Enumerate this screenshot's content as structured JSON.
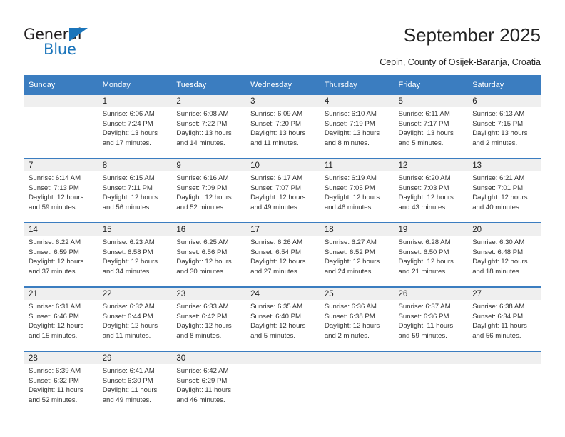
{
  "brand": {
    "word_one": "General",
    "word_two": "Blue",
    "accent_color": "#1b75bb"
  },
  "header": {
    "title": "September 2025",
    "subtitle": "Cepin, County of Osijek-Baranja, Croatia"
  },
  "calendar": {
    "header_bg": "#3b7dc0",
    "daynum_bg": "#efefef",
    "weekday_names": [
      "Sunday",
      "Monday",
      "Tuesday",
      "Wednesday",
      "Thursday",
      "Friday",
      "Saturday"
    ],
    "weeks": [
      [
        {
          "day": "",
          "sunrise": "",
          "sunset": "",
          "daylight_1": "",
          "daylight_2": ""
        },
        {
          "day": "1",
          "sunrise": "Sunrise: 6:06 AM",
          "sunset": "Sunset: 7:24 PM",
          "daylight_1": "Daylight: 13 hours",
          "daylight_2": "and 17 minutes."
        },
        {
          "day": "2",
          "sunrise": "Sunrise: 6:08 AM",
          "sunset": "Sunset: 7:22 PM",
          "daylight_1": "Daylight: 13 hours",
          "daylight_2": "and 14 minutes."
        },
        {
          "day": "3",
          "sunrise": "Sunrise: 6:09 AM",
          "sunset": "Sunset: 7:20 PM",
          "daylight_1": "Daylight: 13 hours",
          "daylight_2": "and 11 minutes."
        },
        {
          "day": "4",
          "sunrise": "Sunrise: 6:10 AM",
          "sunset": "Sunset: 7:19 PM",
          "daylight_1": "Daylight: 13 hours",
          "daylight_2": "and 8 minutes."
        },
        {
          "day": "5",
          "sunrise": "Sunrise: 6:11 AM",
          "sunset": "Sunset: 7:17 PM",
          "daylight_1": "Daylight: 13 hours",
          "daylight_2": "and 5 minutes."
        },
        {
          "day": "6",
          "sunrise": "Sunrise: 6:13 AM",
          "sunset": "Sunset: 7:15 PM",
          "daylight_1": "Daylight: 13 hours",
          "daylight_2": "and 2 minutes."
        }
      ],
      [
        {
          "day": "7",
          "sunrise": "Sunrise: 6:14 AM",
          "sunset": "Sunset: 7:13 PM",
          "daylight_1": "Daylight: 12 hours",
          "daylight_2": "and 59 minutes."
        },
        {
          "day": "8",
          "sunrise": "Sunrise: 6:15 AM",
          "sunset": "Sunset: 7:11 PM",
          "daylight_1": "Daylight: 12 hours",
          "daylight_2": "and 56 minutes."
        },
        {
          "day": "9",
          "sunrise": "Sunrise: 6:16 AM",
          "sunset": "Sunset: 7:09 PM",
          "daylight_1": "Daylight: 12 hours",
          "daylight_2": "and 52 minutes."
        },
        {
          "day": "10",
          "sunrise": "Sunrise: 6:17 AM",
          "sunset": "Sunset: 7:07 PM",
          "daylight_1": "Daylight: 12 hours",
          "daylight_2": "and 49 minutes."
        },
        {
          "day": "11",
          "sunrise": "Sunrise: 6:19 AM",
          "sunset": "Sunset: 7:05 PM",
          "daylight_1": "Daylight: 12 hours",
          "daylight_2": "and 46 minutes."
        },
        {
          "day": "12",
          "sunrise": "Sunrise: 6:20 AM",
          "sunset": "Sunset: 7:03 PM",
          "daylight_1": "Daylight: 12 hours",
          "daylight_2": "and 43 minutes."
        },
        {
          "day": "13",
          "sunrise": "Sunrise: 6:21 AM",
          "sunset": "Sunset: 7:01 PM",
          "daylight_1": "Daylight: 12 hours",
          "daylight_2": "and 40 minutes."
        }
      ],
      [
        {
          "day": "14",
          "sunrise": "Sunrise: 6:22 AM",
          "sunset": "Sunset: 6:59 PM",
          "daylight_1": "Daylight: 12 hours",
          "daylight_2": "and 37 minutes."
        },
        {
          "day": "15",
          "sunrise": "Sunrise: 6:23 AM",
          "sunset": "Sunset: 6:58 PM",
          "daylight_1": "Daylight: 12 hours",
          "daylight_2": "and 34 minutes."
        },
        {
          "day": "16",
          "sunrise": "Sunrise: 6:25 AM",
          "sunset": "Sunset: 6:56 PM",
          "daylight_1": "Daylight: 12 hours",
          "daylight_2": "and 30 minutes."
        },
        {
          "day": "17",
          "sunrise": "Sunrise: 6:26 AM",
          "sunset": "Sunset: 6:54 PM",
          "daylight_1": "Daylight: 12 hours",
          "daylight_2": "and 27 minutes."
        },
        {
          "day": "18",
          "sunrise": "Sunrise: 6:27 AM",
          "sunset": "Sunset: 6:52 PM",
          "daylight_1": "Daylight: 12 hours",
          "daylight_2": "and 24 minutes."
        },
        {
          "day": "19",
          "sunrise": "Sunrise: 6:28 AM",
          "sunset": "Sunset: 6:50 PM",
          "daylight_1": "Daylight: 12 hours",
          "daylight_2": "and 21 minutes."
        },
        {
          "day": "20",
          "sunrise": "Sunrise: 6:30 AM",
          "sunset": "Sunset: 6:48 PM",
          "daylight_1": "Daylight: 12 hours",
          "daylight_2": "and 18 minutes."
        }
      ],
      [
        {
          "day": "21",
          "sunrise": "Sunrise: 6:31 AM",
          "sunset": "Sunset: 6:46 PM",
          "daylight_1": "Daylight: 12 hours",
          "daylight_2": "and 15 minutes."
        },
        {
          "day": "22",
          "sunrise": "Sunrise: 6:32 AM",
          "sunset": "Sunset: 6:44 PM",
          "daylight_1": "Daylight: 12 hours",
          "daylight_2": "and 11 minutes."
        },
        {
          "day": "23",
          "sunrise": "Sunrise: 6:33 AM",
          "sunset": "Sunset: 6:42 PM",
          "daylight_1": "Daylight: 12 hours",
          "daylight_2": "and 8 minutes."
        },
        {
          "day": "24",
          "sunrise": "Sunrise: 6:35 AM",
          "sunset": "Sunset: 6:40 PM",
          "daylight_1": "Daylight: 12 hours",
          "daylight_2": "and 5 minutes."
        },
        {
          "day": "25",
          "sunrise": "Sunrise: 6:36 AM",
          "sunset": "Sunset: 6:38 PM",
          "daylight_1": "Daylight: 12 hours",
          "daylight_2": "and 2 minutes."
        },
        {
          "day": "26",
          "sunrise": "Sunrise: 6:37 AM",
          "sunset": "Sunset: 6:36 PM",
          "daylight_1": "Daylight: 11 hours",
          "daylight_2": "and 59 minutes."
        },
        {
          "day": "27",
          "sunrise": "Sunrise: 6:38 AM",
          "sunset": "Sunset: 6:34 PM",
          "daylight_1": "Daylight: 11 hours",
          "daylight_2": "and 56 minutes."
        }
      ],
      [
        {
          "day": "28",
          "sunrise": "Sunrise: 6:39 AM",
          "sunset": "Sunset: 6:32 PM",
          "daylight_1": "Daylight: 11 hours",
          "daylight_2": "and 52 minutes."
        },
        {
          "day": "29",
          "sunrise": "Sunrise: 6:41 AM",
          "sunset": "Sunset: 6:30 PM",
          "daylight_1": "Daylight: 11 hours",
          "daylight_2": "and 49 minutes."
        },
        {
          "day": "30",
          "sunrise": "Sunrise: 6:42 AM",
          "sunset": "Sunset: 6:29 PM",
          "daylight_1": "Daylight: 11 hours",
          "daylight_2": "and 46 minutes."
        },
        {
          "day": "",
          "sunrise": "",
          "sunset": "",
          "daylight_1": "",
          "daylight_2": ""
        },
        {
          "day": "",
          "sunrise": "",
          "sunset": "",
          "daylight_1": "",
          "daylight_2": ""
        },
        {
          "day": "",
          "sunrise": "",
          "sunset": "",
          "daylight_1": "",
          "daylight_2": ""
        },
        {
          "day": "",
          "sunrise": "",
          "sunset": "",
          "daylight_1": "",
          "daylight_2": ""
        }
      ]
    ]
  }
}
